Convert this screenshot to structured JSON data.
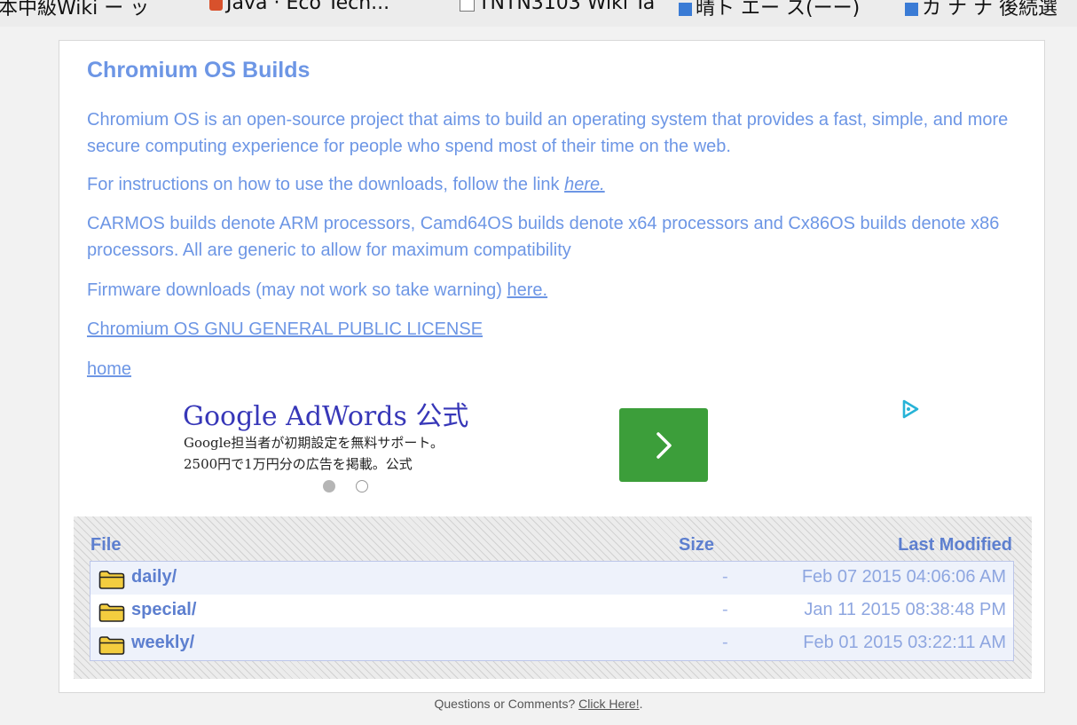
{
  "bookmarks": [
    {
      "label": "本中級Wiki ー ッ"
    },
    {
      "label": "Java · Eco Tech..."
    },
    {
      "label": "TNTN3103 Wiki Ta"
    },
    {
      "label": "晴ト エー ス(ーー)"
    },
    {
      "label": "カ ナ ナ 後続選"
    }
  ],
  "page": {
    "title": "Chromium OS Builds",
    "intro": "Chromium OS is an open-source project that aims to build an operating system that provides a fast, simple, and more secure computing experience for people who spend most of their time on the web.",
    "instructions_text": "For instructions on how to use the downloads, follow the link ",
    "instructions_link": "here.",
    "arch_text": "CARMOS builds denote ARM processors, Camd64OS builds denote x64 processors and Cx86OS builds denote x86 processors. All are generic to allow for maximum compatibility",
    "firmware_text": "Firmware downloads (may not work so take warning) ",
    "firmware_link": "here.",
    "license_link": "Chromium OS GNU GENERAL PUBLIC LICENSE",
    "home_link": "home"
  },
  "ad": {
    "title": "Google AdWords 公式",
    "line1": "Google担当者が初期設定を無料サポート。",
    "line2": "2500円で1万円分の広告を掲載。公式",
    "button_color": "#3c9e3a"
  },
  "listing": {
    "headers": {
      "file": "File",
      "size": "Size",
      "modified": "Last Modified"
    },
    "rows": [
      {
        "name": "daily/",
        "size": "-",
        "modified": "Feb 07 2015 04:06:06 AM"
      },
      {
        "name": "special/",
        "size": "-",
        "modified": "Jan 11 2015 08:38:48 PM"
      },
      {
        "name": "weekly/",
        "size": "-",
        "modified": "Feb 01 2015 03:22:11 AM"
      }
    ]
  },
  "footer": {
    "text": "Questions or Comments? ",
    "link": "Click Here!",
    "suffix": "."
  },
  "colors": {
    "accent": "#6d96e5",
    "table_header": "#5d7fcf"
  }
}
